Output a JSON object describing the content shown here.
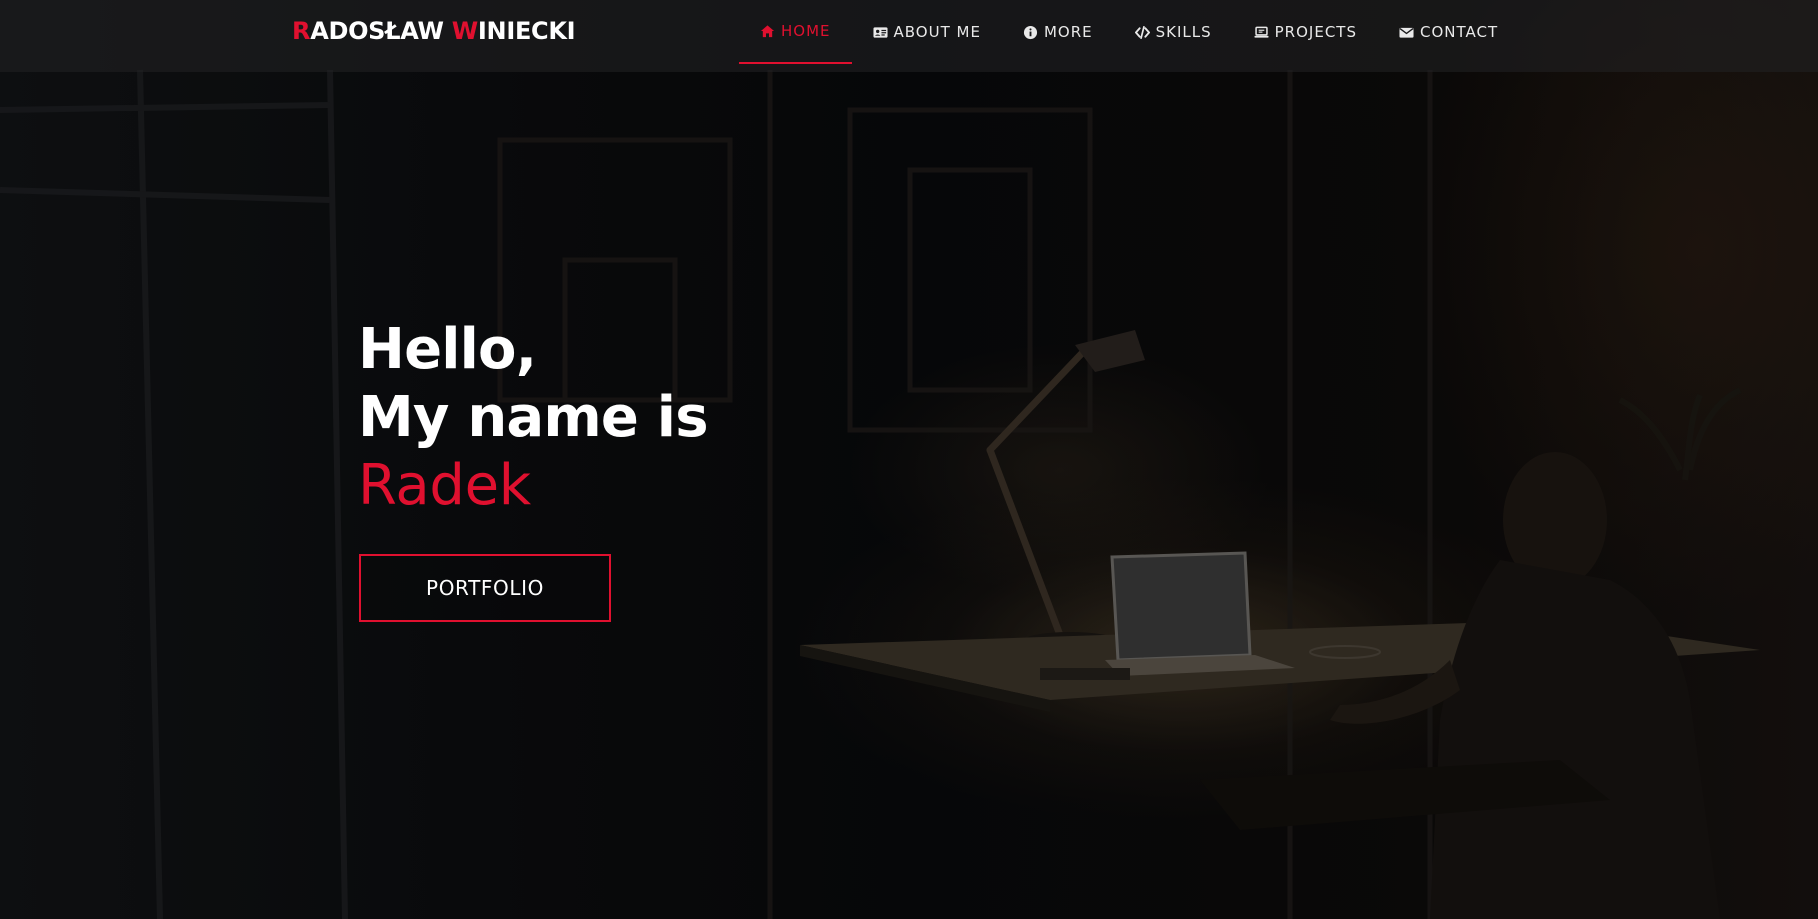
{
  "brand": {
    "first_initial": "R",
    "first_rest": "ADOSŁAW ",
    "last_initial": "W",
    "last_rest": "INIECKI"
  },
  "nav": {
    "items": [
      {
        "label": "HOME",
        "icon": "home-icon",
        "active": true
      },
      {
        "label": "ABOUT ME",
        "icon": "id-card-icon",
        "active": false
      },
      {
        "label": "MORE",
        "icon": "info-icon",
        "active": false
      },
      {
        "label": "SKILLS",
        "icon": "code-icon",
        "active": false
      },
      {
        "label": "PROJECTS",
        "icon": "laptop-icon",
        "active": false
      },
      {
        "label": "CONTACT",
        "icon": "envelope-icon",
        "active": false
      }
    ]
  },
  "hero": {
    "line1": "Hello,",
    "line2": "My name is",
    "name": "Radek",
    "button_label": "PORTFOLIO",
    "background_image": "dark-room-desk-lamp-laptop-person"
  },
  "colors": {
    "accent": "#e0102f",
    "text": "#ffffff",
    "navbar_bg": "#222224"
  }
}
